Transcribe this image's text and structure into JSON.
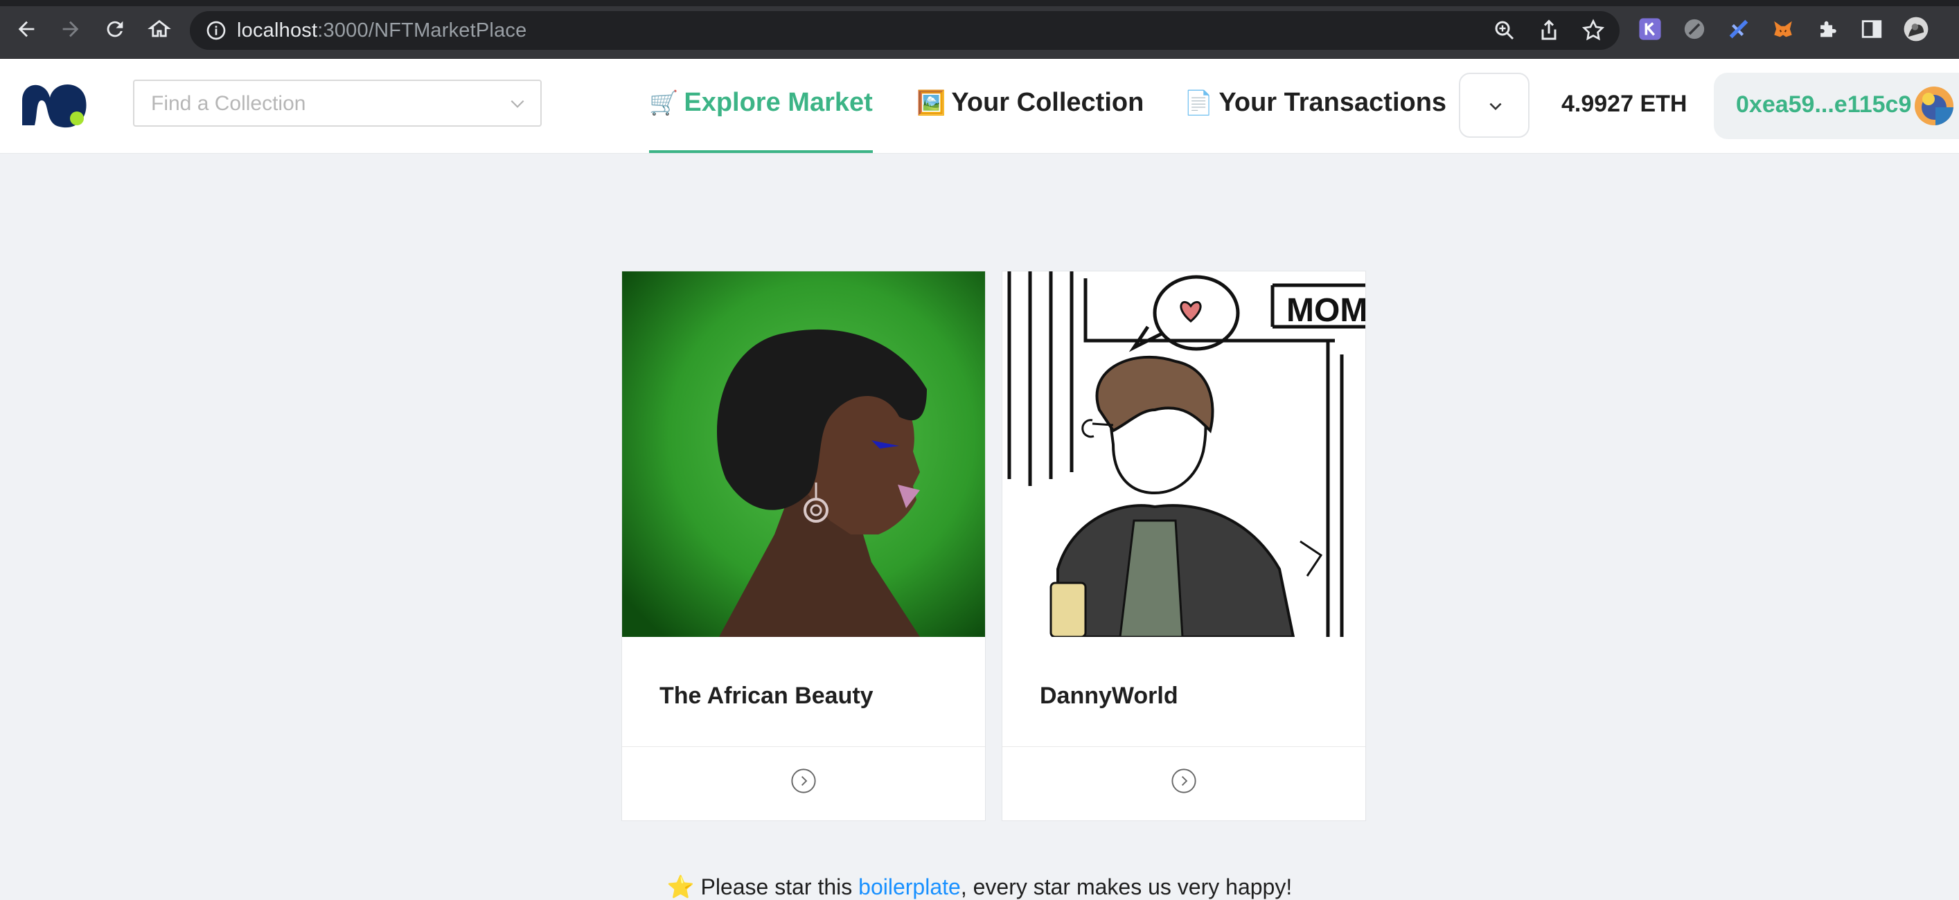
{
  "browser": {
    "url_host": "localhost",
    "url_path": ":3000/NFTMarketPlace"
  },
  "header": {
    "search_placeholder": "Find a Collection",
    "tabs": [
      {
        "emoji": "🛒",
        "label": "Explore Market",
        "active": true
      },
      {
        "emoji": "🖼️",
        "label": "Your Collection",
        "active": false
      },
      {
        "emoji": "📄",
        "label": "Your Transactions",
        "active": false
      }
    ],
    "balance": "4.9927 ETH",
    "account": "0xea59...e115c9"
  },
  "collections": [
    {
      "name": "The African Beauty"
    },
    {
      "name": "DannyWorld"
    }
  ],
  "footnote": {
    "star": "⭐",
    "prefix": "Please star this",
    "link": "boilerplate",
    "suffix": ", every star makes us very happy!"
  },
  "colors": {
    "accent": "#3cb486",
    "page_bg": "#f0f2f5",
    "logo": "#0f2a5c",
    "logo_dot": "#a6e22e",
    "link": "#1890ff"
  }
}
